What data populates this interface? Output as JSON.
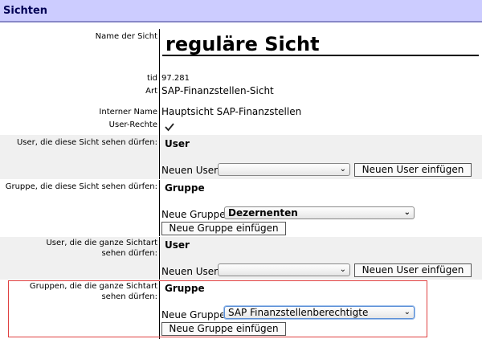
{
  "header": {
    "title": "Sichten"
  },
  "fields": {
    "name_label": "Name der Sicht",
    "name_value": "reguläre Sicht",
    "tid_label": "tid",
    "tid_value": "97.281",
    "art_label": "Art",
    "art_value": "SAP-Finanzstellen-Sicht",
    "internal_label": "Interner Name",
    "internal_value": "Hauptsicht SAP-Finanzstellen",
    "rights_label": "User-Rechte",
    "rights_checked": true
  },
  "sections": [
    {
      "label": "User, die diese Sicht sehen dürfen:",
      "heading": "User",
      "new_label": "Neuen User",
      "select_value": "",
      "button": "Neuen User einfügen"
    },
    {
      "label": "Gruppe, die diese Sicht sehen dürfen:",
      "heading": "Gruppe",
      "new_label": "Neue Gruppe",
      "select_value": "Dezernenten",
      "button": "Neue Gruppe einfügen"
    },
    {
      "label": "User, die die ganze Sichtart sehen dürfen:",
      "heading": "User",
      "new_label": "Neuen User",
      "select_value": "",
      "button": "Neuen User einfügen"
    },
    {
      "label": "Gruppen, die die ganze Sichtart sehen dürfen:",
      "heading": "Gruppe",
      "new_label": "Neue Gruppe",
      "select_value": "SAP Finanzstellenberechtigte",
      "button": "Neue Gruppe einfügen"
    }
  ],
  "colors": {
    "header_bg": "#ccccff",
    "band_bg": "#f0f0f0",
    "highlight": "#e04040",
    "focus": "#5b8fd6"
  }
}
